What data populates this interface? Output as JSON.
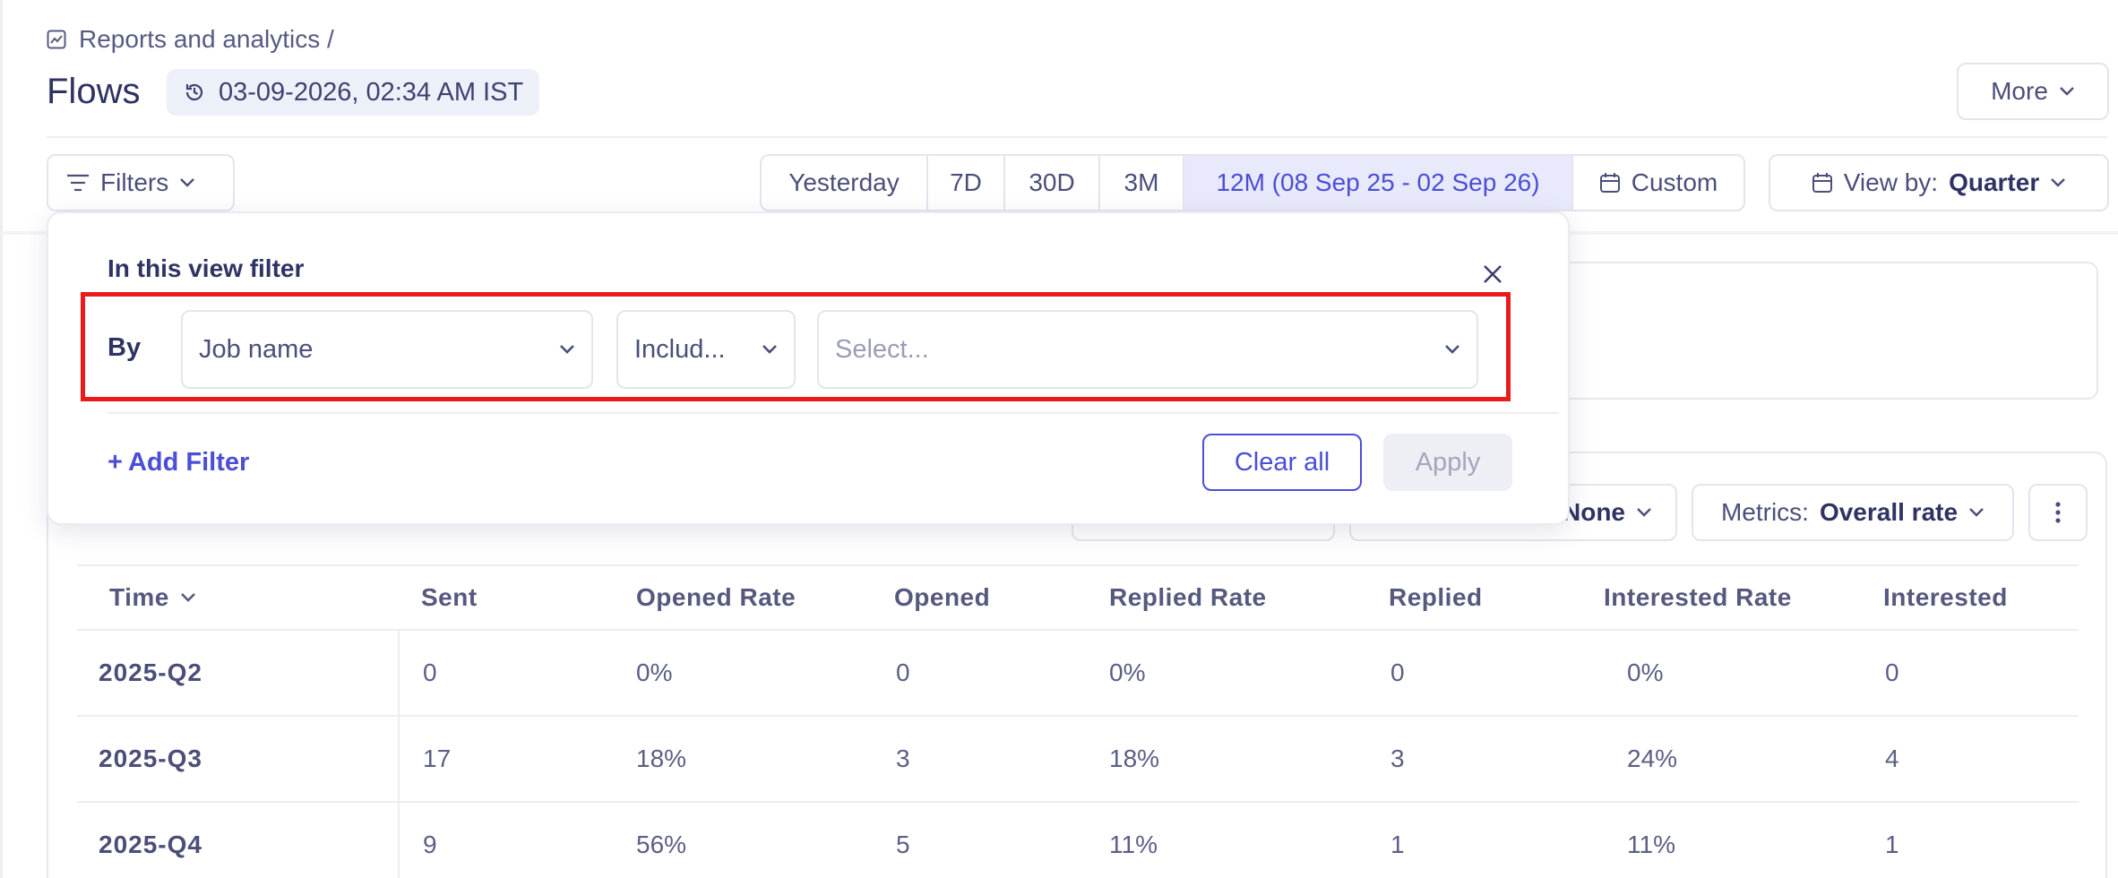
{
  "breadcrumb": {
    "icon": "chart-icon",
    "label": "Reports and analytics /"
  },
  "page": {
    "title": "Flows",
    "timestamp": "03-09-2026, 02:34 AM IST"
  },
  "header": {
    "more_label": "More"
  },
  "toolbar": {
    "filters_label": "Filters",
    "ranges": [
      {
        "label": "Yesterday",
        "active": false
      },
      {
        "label": "7D",
        "active": false
      },
      {
        "label": "30D",
        "active": false
      },
      {
        "label": "3M",
        "active": false
      },
      {
        "label": "12M (08 Sep 25 - 02 Sep 26)",
        "active": true
      },
      {
        "label": "Custom",
        "active": false
      }
    ],
    "view_by_prefix": "View by:",
    "view_by_value": "Quarter"
  },
  "table_controls": {
    "group_by_value": "None",
    "metrics_prefix": "Metrics:",
    "metrics_value": "Overall rate"
  },
  "table": {
    "columns": [
      "Time",
      "Sent",
      "Opened Rate",
      "Opened",
      "Replied Rate",
      "Replied",
      "Interested Rate",
      "Interested"
    ],
    "rows": [
      [
        "2025-Q2",
        "0",
        "0%",
        "0",
        "0%",
        "0",
        "0%",
        "0"
      ],
      [
        "2025-Q3",
        "17",
        "18%",
        "3",
        "18%",
        "3",
        "24%",
        "4"
      ],
      [
        "2025-Q4",
        "9",
        "56%",
        "5",
        "11%",
        "1",
        "11%",
        "1"
      ]
    ]
  },
  "filter_popover": {
    "title": "In this view filter",
    "by_label": "By",
    "field_value": "Job name",
    "operator_value": "Includ...",
    "value_placeholder": "Select...",
    "add_filter_label": "Add Filter",
    "clear_all_label": "Clear all",
    "apply_label": "Apply"
  },
  "colors": {
    "accent": "#4b4ed6",
    "highlight": "#ec1b1b",
    "text": "#3b3f6b"
  }
}
